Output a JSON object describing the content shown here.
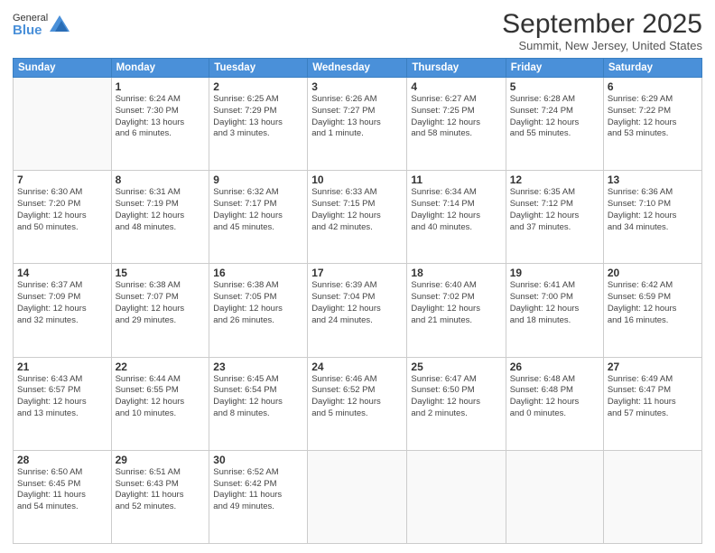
{
  "logo": {
    "general": "General",
    "blue": "Blue"
  },
  "header": {
    "month": "September 2025",
    "location": "Summit, New Jersey, United States"
  },
  "days_of_week": [
    "Sunday",
    "Monday",
    "Tuesday",
    "Wednesday",
    "Thursday",
    "Friday",
    "Saturday"
  ],
  "weeks": [
    [
      {
        "num": "",
        "info": ""
      },
      {
        "num": "1",
        "info": "Sunrise: 6:24 AM\nSunset: 7:30 PM\nDaylight: 13 hours\nand 6 minutes."
      },
      {
        "num": "2",
        "info": "Sunrise: 6:25 AM\nSunset: 7:29 PM\nDaylight: 13 hours\nand 3 minutes."
      },
      {
        "num": "3",
        "info": "Sunrise: 6:26 AM\nSunset: 7:27 PM\nDaylight: 13 hours\nand 1 minute."
      },
      {
        "num": "4",
        "info": "Sunrise: 6:27 AM\nSunset: 7:25 PM\nDaylight: 12 hours\nand 58 minutes."
      },
      {
        "num": "5",
        "info": "Sunrise: 6:28 AM\nSunset: 7:24 PM\nDaylight: 12 hours\nand 55 minutes."
      },
      {
        "num": "6",
        "info": "Sunrise: 6:29 AM\nSunset: 7:22 PM\nDaylight: 12 hours\nand 53 minutes."
      }
    ],
    [
      {
        "num": "7",
        "info": "Sunrise: 6:30 AM\nSunset: 7:20 PM\nDaylight: 12 hours\nand 50 minutes."
      },
      {
        "num": "8",
        "info": "Sunrise: 6:31 AM\nSunset: 7:19 PM\nDaylight: 12 hours\nand 48 minutes."
      },
      {
        "num": "9",
        "info": "Sunrise: 6:32 AM\nSunset: 7:17 PM\nDaylight: 12 hours\nand 45 minutes."
      },
      {
        "num": "10",
        "info": "Sunrise: 6:33 AM\nSunset: 7:15 PM\nDaylight: 12 hours\nand 42 minutes."
      },
      {
        "num": "11",
        "info": "Sunrise: 6:34 AM\nSunset: 7:14 PM\nDaylight: 12 hours\nand 40 minutes."
      },
      {
        "num": "12",
        "info": "Sunrise: 6:35 AM\nSunset: 7:12 PM\nDaylight: 12 hours\nand 37 minutes."
      },
      {
        "num": "13",
        "info": "Sunrise: 6:36 AM\nSunset: 7:10 PM\nDaylight: 12 hours\nand 34 minutes."
      }
    ],
    [
      {
        "num": "14",
        "info": "Sunrise: 6:37 AM\nSunset: 7:09 PM\nDaylight: 12 hours\nand 32 minutes."
      },
      {
        "num": "15",
        "info": "Sunrise: 6:38 AM\nSunset: 7:07 PM\nDaylight: 12 hours\nand 29 minutes."
      },
      {
        "num": "16",
        "info": "Sunrise: 6:38 AM\nSunset: 7:05 PM\nDaylight: 12 hours\nand 26 minutes."
      },
      {
        "num": "17",
        "info": "Sunrise: 6:39 AM\nSunset: 7:04 PM\nDaylight: 12 hours\nand 24 minutes."
      },
      {
        "num": "18",
        "info": "Sunrise: 6:40 AM\nSunset: 7:02 PM\nDaylight: 12 hours\nand 21 minutes."
      },
      {
        "num": "19",
        "info": "Sunrise: 6:41 AM\nSunset: 7:00 PM\nDaylight: 12 hours\nand 18 minutes."
      },
      {
        "num": "20",
        "info": "Sunrise: 6:42 AM\nSunset: 6:59 PM\nDaylight: 12 hours\nand 16 minutes."
      }
    ],
    [
      {
        "num": "21",
        "info": "Sunrise: 6:43 AM\nSunset: 6:57 PM\nDaylight: 12 hours\nand 13 minutes."
      },
      {
        "num": "22",
        "info": "Sunrise: 6:44 AM\nSunset: 6:55 PM\nDaylight: 12 hours\nand 10 minutes."
      },
      {
        "num": "23",
        "info": "Sunrise: 6:45 AM\nSunset: 6:54 PM\nDaylight: 12 hours\nand 8 minutes."
      },
      {
        "num": "24",
        "info": "Sunrise: 6:46 AM\nSunset: 6:52 PM\nDaylight: 12 hours\nand 5 minutes."
      },
      {
        "num": "25",
        "info": "Sunrise: 6:47 AM\nSunset: 6:50 PM\nDaylight: 12 hours\nand 2 minutes."
      },
      {
        "num": "26",
        "info": "Sunrise: 6:48 AM\nSunset: 6:48 PM\nDaylight: 12 hours\nand 0 minutes."
      },
      {
        "num": "27",
        "info": "Sunrise: 6:49 AM\nSunset: 6:47 PM\nDaylight: 11 hours\nand 57 minutes."
      }
    ],
    [
      {
        "num": "28",
        "info": "Sunrise: 6:50 AM\nSunset: 6:45 PM\nDaylight: 11 hours\nand 54 minutes."
      },
      {
        "num": "29",
        "info": "Sunrise: 6:51 AM\nSunset: 6:43 PM\nDaylight: 11 hours\nand 52 minutes."
      },
      {
        "num": "30",
        "info": "Sunrise: 6:52 AM\nSunset: 6:42 PM\nDaylight: 11 hours\nand 49 minutes."
      },
      {
        "num": "",
        "info": ""
      },
      {
        "num": "",
        "info": ""
      },
      {
        "num": "",
        "info": ""
      },
      {
        "num": "",
        "info": ""
      }
    ]
  ]
}
